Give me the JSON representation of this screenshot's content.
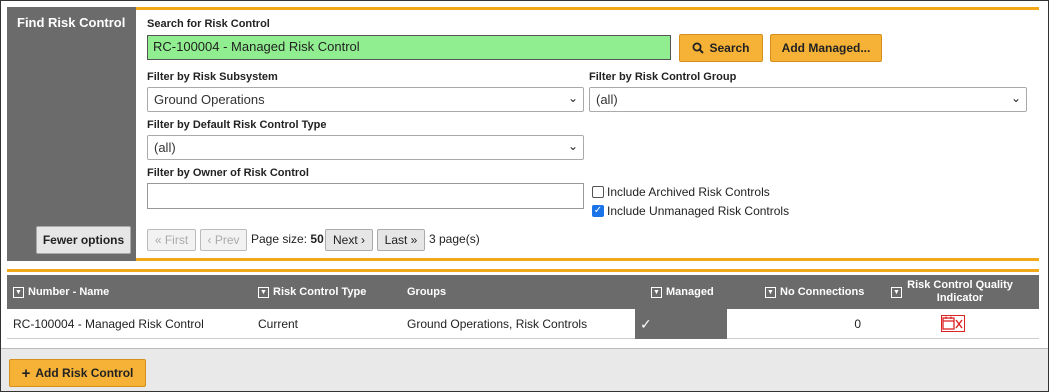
{
  "panel": {
    "title": "Find Risk Control",
    "fewer_options_label": "Fewer options"
  },
  "search": {
    "label": "Search for Risk Control",
    "value": "RC-100004 - Managed Risk Control",
    "search_button": "Search",
    "add_managed_button": "Add Managed..."
  },
  "filters": {
    "subsystem": {
      "label": "Filter by Risk Subsystem",
      "selected": "Ground Operations"
    },
    "group": {
      "label": "Filter by Risk Control Group",
      "selected": "(all)"
    },
    "type": {
      "label": "Filter by Default Risk Control Type",
      "selected": "(all)"
    },
    "owner": {
      "label": "Filter by Owner of Risk Control",
      "value": ""
    },
    "include_archived": {
      "label": "Include Archived Risk Controls",
      "checked": false
    },
    "include_unmanaged": {
      "label": "Include Unmanaged Risk Controls",
      "checked": true
    }
  },
  "pager": {
    "first": "« First",
    "prev": "‹ Prev",
    "page_size_label": "Page size:",
    "page_size_value": "50",
    "next": "Next ›",
    "last": "Last »",
    "page_count": "3 page(s)"
  },
  "table": {
    "headers": {
      "number_name": "Number - Name",
      "type": "Risk Control Type",
      "groups": "Groups",
      "managed": "Managed",
      "no_connections": "No Connections",
      "quality_line1": "Risk Control Quality",
      "quality_line2": "Indicator"
    },
    "rows": [
      {
        "number_name": "RC-100004 - Managed Risk Control",
        "type": "Current",
        "groups": "Ground Operations, Risk Controls",
        "managed": "✓",
        "no_connections": "0"
      }
    ]
  },
  "footer": {
    "add_button": "Add Risk Control"
  },
  "colors": {
    "accent": "#f3a81a",
    "header_gray": "#6b6b6b",
    "search_green": "#90ee90",
    "indicator_red": "#dd2222"
  },
  "icons": {
    "search": "magnifier-icon",
    "add": "plus-icon",
    "dropdown": "chevron-down-icon",
    "filter": "column-filter-icon",
    "quality": "calendar-x-icon"
  }
}
